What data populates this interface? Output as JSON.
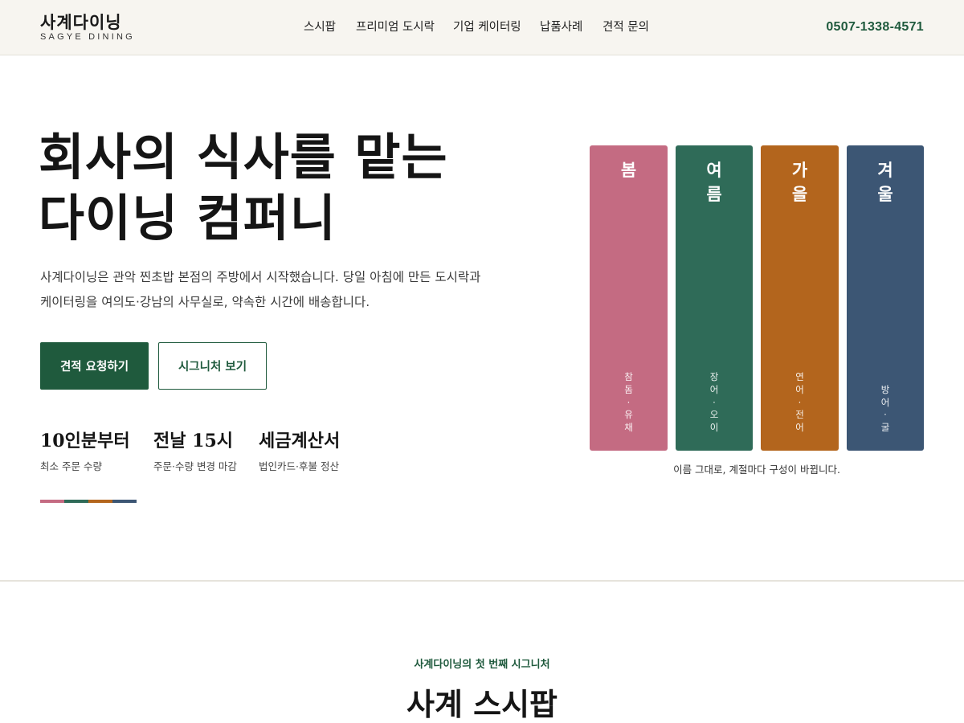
{
  "header": {
    "logo_ko": "사계다이닝",
    "logo_en": "SAGYE DINING",
    "nav": [
      "스시팝",
      "프리미엄 도시락",
      "기업 케이터링",
      "납품사례",
      "견적 문의"
    ],
    "phone": "0507-1338-4571"
  },
  "hero": {
    "title_lines": [
      "회사의 식사를 맡는",
      "다이닝 컴퍼니"
    ],
    "desc_lines": [
      "사계다이닝은 관악 찐초밥 본점의 주방에서 시작했습니다. 당일 아침에 만든 도시락과",
      "케이터링을 여의도·강남의 사무실로, 약속한 시간에 배송합니다."
    ],
    "primary_button": "견적 요청하기",
    "secondary_button": "시그니처 보기",
    "stats": [
      {
        "value": "10인분부터",
        "label": "최소 주문 수량"
      },
      {
        "value": "전날 15시",
        "label": "주문·수량 변경 마감"
      },
      {
        "value": "세금계산서",
        "label": "법인카드·후불 정산"
      }
    ]
  },
  "seasons": [
    {
      "name": [
        "봄"
      ],
      "items": [
        "참",
        "돔",
        "·",
        "유",
        "채"
      ],
      "color": "#c46b82"
    },
    {
      "name": [
        "여",
        "름"
      ],
      "items": [
        "장",
        "어",
        "·",
        "오",
        "이"
      ],
      "color": "#2f6b58"
    },
    {
      "name": [
        "가",
        "을"
      ],
      "items": [
        "연",
        "어",
        "·",
        "전",
        "어"
      ],
      "color": "#b3651d"
    },
    {
      "name": [
        "겨",
        "울"
      ],
      "items": [
        "방",
        "어",
        "·",
        "굴"
      ],
      "color": "#3c5674"
    }
  ],
  "seasons_caption": "이름 그대로, 계절마다 구성이 바뀝니다.",
  "section": {
    "eyebrow": "사계다이닝의 첫 번째 시그니처",
    "title": "사계 스시팝"
  },
  "colors": {
    "brand_green": "#1f5a3d",
    "spring": "#c46b82",
    "summer": "#2f6b58",
    "autumn": "#b3651d",
    "winter": "#3c5674"
  }
}
